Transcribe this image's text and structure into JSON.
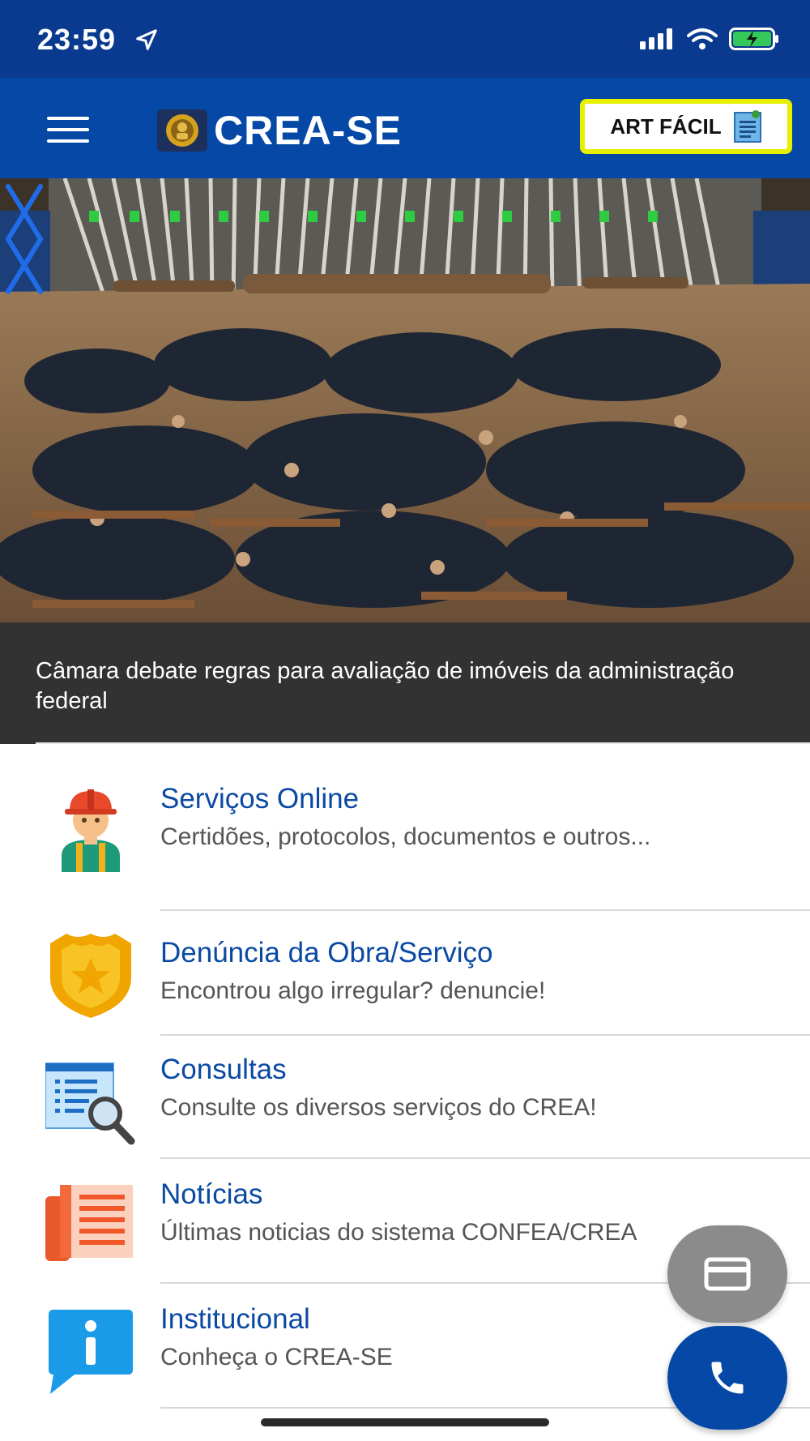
{
  "status_bar": {
    "time": "23:59"
  },
  "header": {
    "logo_text": "CREA-SE",
    "art_button_label": "ART FÁCIL",
    "colors": {
      "header_bg": "#0648a6",
      "status_bg": "#0a3a8f",
      "art_border": "#e6f000"
    }
  },
  "banner": {
    "caption": "Câmara debate regras para avaliação de imóveis da administração federal"
  },
  "menu": {
    "items": [
      {
        "title": "Serviços Online",
        "subtitle": "Certidões, protocolos, documentos e outros...",
        "icon": "worker-icon"
      },
      {
        "title": "Denúncia da Obra/Serviço",
        "subtitle": "Encontrou algo irregular? denuncie!",
        "icon": "badge-star-icon"
      },
      {
        "title": "Consultas",
        "subtitle": "Consulte os diversos serviços do CREA!",
        "icon": "search-document-icon"
      },
      {
        "title": "Notícias",
        "subtitle": "Últimas noticias do sistema CONFEA/CREA",
        "icon": "newspaper-icon"
      },
      {
        "title": "Institucional",
        "subtitle": "Conheça o CREA-SE",
        "icon": "info-icon"
      }
    ]
  },
  "fabs": {
    "card_icon": "credit-card-icon",
    "phone_icon": "phone-icon"
  }
}
